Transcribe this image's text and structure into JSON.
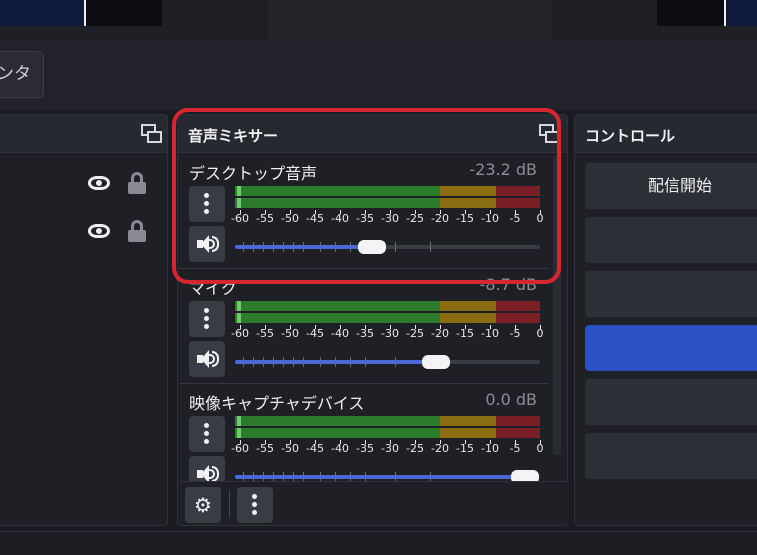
{
  "toolbar": {
    "partial_button_label": "ンタ"
  },
  "mixer": {
    "title": "音声ミキサー",
    "scale_labels": [
      "-60",
      "-55",
      "-50",
      "-45",
      "-40",
      "-35",
      "-30",
      "-25",
      "-20",
      "-15",
      "-10",
      "-5",
      "0"
    ],
    "channels": [
      {
        "name": "デスクトップ音声",
        "db": "-23.2 dB",
        "volume_fraction": 0.45
      },
      {
        "name": "マイク",
        "db": "-8.7 dB",
        "volume_fraction": 0.66
      },
      {
        "name": "映像キャプチャデバイス",
        "db": "0.0 dB",
        "volume_fraction": 0.95
      }
    ]
  },
  "controls": {
    "title": "コントロール",
    "buttons": [
      {
        "label": "配信開始"
      },
      {
        "label": ""
      },
      {
        "label": ""
      },
      {
        "label": ""
      },
      {
        "label": ""
      },
      {
        "label": ""
      }
    ]
  },
  "colors": {
    "accent": "#2b4fc4",
    "highlight": "#d6262f",
    "meter_green": "#2c7a2c",
    "meter_yellow": "#8a6c12",
    "meter_red": "#7a1f26"
  }
}
